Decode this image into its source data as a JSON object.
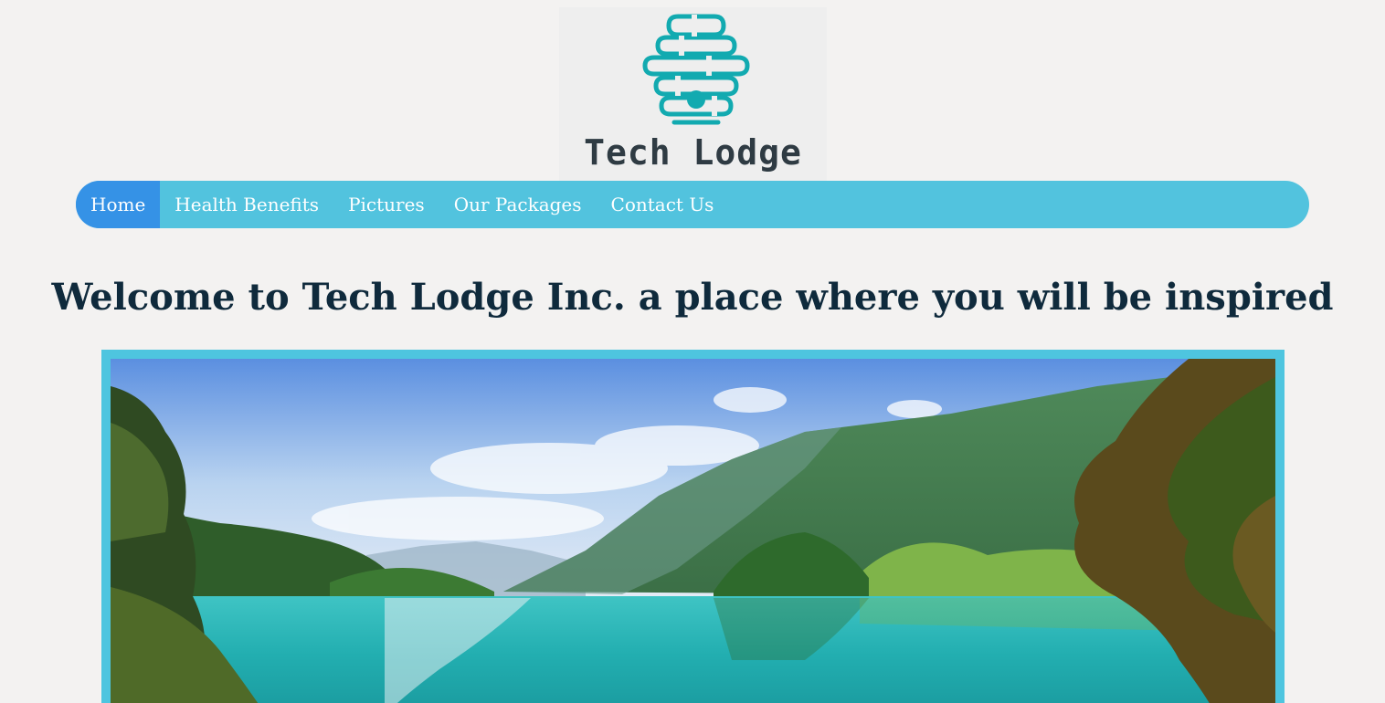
{
  "logo": {
    "icon": "beehive-brain-icon",
    "text": "Tech Lodge",
    "color": "#12aab0"
  },
  "nav": {
    "items": [
      {
        "label": "Home",
        "active": true
      },
      {
        "label": "Health Benefits",
        "active": false
      },
      {
        "label": "Pictures",
        "active": false
      },
      {
        "label": "Our Packages",
        "active": false
      },
      {
        "label": "Contact Us",
        "active": false
      }
    ],
    "background": "#52c3de",
    "active_background": "#3592e6"
  },
  "hero": {
    "heading": "Welcome to Tech Lodge Inc. a place where you will be inspired",
    "frame_color": "#4ec5df"
  }
}
